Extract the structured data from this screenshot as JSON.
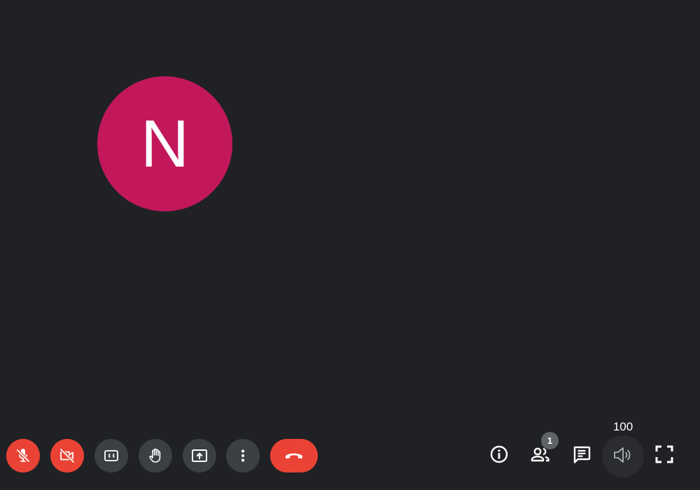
{
  "participant": {
    "initial": "N",
    "avatar_color": "#c2185b"
  },
  "controls": {
    "mic": {
      "icon": "mic-off-icon",
      "state": "muted",
      "color": "#ea4335"
    },
    "camera": {
      "icon": "videocam-off-icon",
      "state": "off",
      "color": "#ea4335"
    },
    "captions": {
      "icon": "closed-captions-icon",
      "color": "#3c4043"
    },
    "raise_hand": {
      "icon": "hand-icon",
      "color": "#3c4043"
    },
    "present": {
      "icon": "present-screen-icon",
      "color": "#3c4043"
    },
    "more": {
      "icon": "more-vert-icon",
      "color": "#3c4043"
    },
    "hangup": {
      "icon": "call-end-icon",
      "color": "#ea4335"
    }
  },
  "right_controls": {
    "info": {
      "icon": "info-icon"
    },
    "people": {
      "icon": "people-icon",
      "count": "1"
    },
    "chat": {
      "icon": "chat-icon"
    },
    "volume": {
      "icon": "volume-icon",
      "level": "100"
    },
    "fullscreen": {
      "icon": "fullscreen-icon"
    }
  }
}
